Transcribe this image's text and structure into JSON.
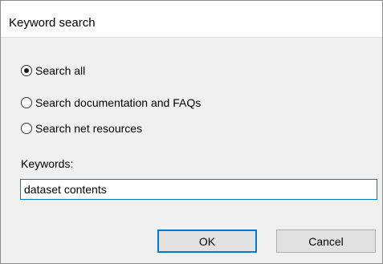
{
  "window": {
    "title": "Keyword search"
  },
  "search_scope": {
    "options": [
      {
        "label": "Search all",
        "checked": true
      },
      {
        "label": "Search documentation and FAQs",
        "checked": false
      },
      {
        "label": "Search net resources",
        "checked": false
      }
    ]
  },
  "keywords": {
    "label": "Keywords:",
    "value": "dataset contents"
  },
  "buttons": {
    "ok_label": "OK",
    "cancel_label": "Cancel"
  },
  "colors": {
    "accent": "#0078d7",
    "dialog_background": "#f0f0f0",
    "title_background": "#ffffff",
    "button_face": "#e1e1e1"
  }
}
